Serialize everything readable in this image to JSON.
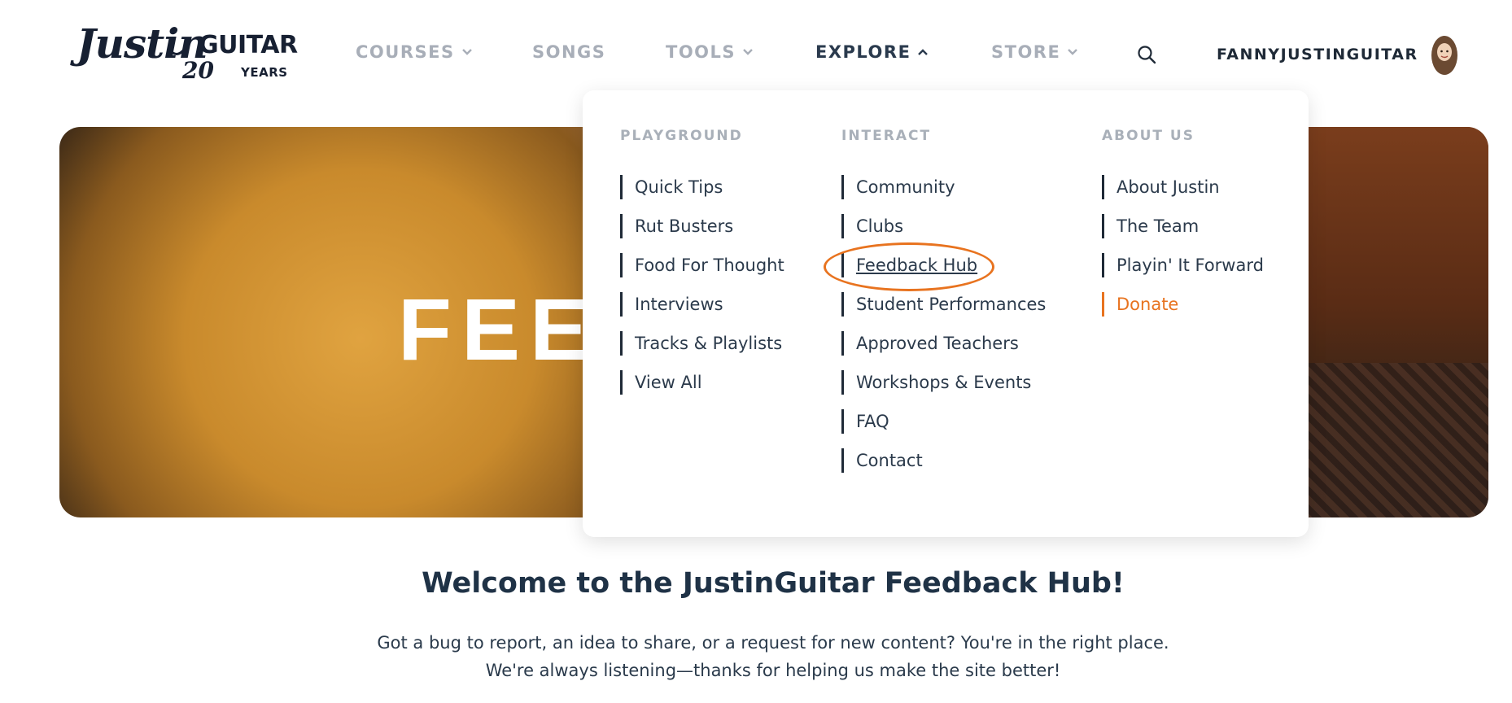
{
  "logo": {
    "word": "Justin",
    "guitar": "GUITAR",
    "twenty": "20",
    "years": "YEARS"
  },
  "nav": {
    "courses": "COURSES",
    "songs": "SONGS",
    "tools": "TOOLS",
    "explore": "EXPLORE",
    "store": "STORE",
    "search_icon": "search-icon",
    "username": "FANNYJUSTINGUITAR"
  },
  "hero": {
    "title": "FEEDBACK HUB"
  },
  "dropdown": {
    "columns": [
      {
        "heading": "PLAYGROUND",
        "links": [
          "Quick Tips",
          "Rut Busters",
          "Food For Thought",
          "Interviews",
          "Tracks & Playlists",
          "View All"
        ]
      },
      {
        "heading": "INTERACT",
        "links": [
          "Community",
          "Clubs",
          "Feedback Hub",
          "Student Performances",
          "Approved Teachers",
          "Workshops & Events",
          "FAQ",
          "Contact"
        ]
      },
      {
        "heading": "ABOUT US",
        "links": [
          "About Justin",
          "The Team",
          "Playin' It Forward",
          "Donate"
        ]
      }
    ]
  },
  "colors": {
    "accent": "#e8731f",
    "text_dark": "#1f3246",
    "nav_muted": "#a8aeb8"
  },
  "main": {
    "welcome_title": "Welcome to the JustinGuitar Feedback Hub!",
    "intro_line1": "Got a bug to report, an idea to share, or a request for new content? You're in the right place.",
    "intro_line2": "We're always listening—thanks for helping us make the site better!"
  }
}
